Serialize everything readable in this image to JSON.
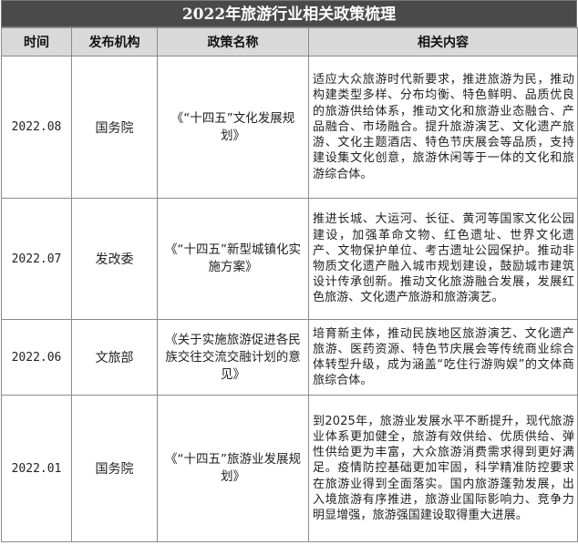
{
  "title": "2022年旅游行业相关政策梳理",
  "headers": {
    "time": "时间",
    "org": "发布机构",
    "policy": "政策名称",
    "content": "相关内容"
  },
  "rows": [
    {
      "time": "2022.08",
      "org": "国务院",
      "policy": "《“十四五”文化发展规划》",
      "content": "适应大众旅游时代新要求，推进旅游为民，推动构建类型多样、分布均衡、特色鲜明、品质优良的旅游供给体系，推动文化和旅游业态融合、产品融合、市场融合。提升旅游演艺、文化遗产旅游、文化主题酒店、特色节庆展会等品质，支持建设集文化创意，旅游休闲等于一体的文化和旅游综合体。"
    },
    {
      "time": "2022.07",
      "org": "发改委",
      "policy": "《“十四五”新型城镇化实施方案》",
      "content": "推进长城、大运河、长征、黄河等国家文化公园建设，加强革命文物、红色遗址、世界文化遗产、文物保护单位、考古遗址公园保护。推动非物质文化遗产融入城市规划建设，鼓励城市建筑设计传承创新。推动文化旅游融合发展，发展红色旅游、文化遗产旅游和旅游演艺。"
    },
    {
      "time": "2022.06",
      "org": "文旅部",
      "policy": "《关于实施旅游促进各民族交往交流交融计划的意见》",
      "content": "培育新主体，推动民族地区旅游演艺、文化遗产旅游、医药资源、特色节庆展会等传统商业综合体转型升级，成为涵盖“吃住行游购娱”的文体商旅综合体。"
    },
    {
      "time": "2022.01",
      "org": "国务院",
      "policy": "《“十四五”旅游业发展规划》",
      "content": "到2025年，旅游业发展水平不断提升，现代旅游业体系更加健全，旅游有效供给、优质供给、弹性供给更为丰富，大众旅游消费需求得到更好满足。疫情防控基础更加牢固，科学精准防控要求在旅游业得到全面落实。国内旅游蓬勃发展，出入境旅游有序推进，旅游业国际影响力、竞争力明显增强，旅游强国建设取得重大进展。"
    }
  ]
}
